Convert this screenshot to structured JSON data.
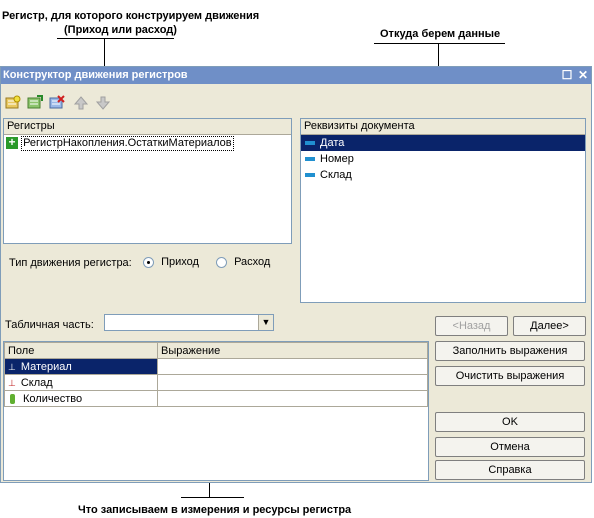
{
  "annotations": {
    "register_note_line1": "Регистр, для которого конструируем движения",
    "register_note_line2": "(Приход или расход)",
    "source_note": "Откуда берем данные",
    "bottom_note": "Что записываем в измерения и ресурсы регистра"
  },
  "window": {
    "title": "Конструктор движения регистров"
  },
  "registers_panel": {
    "header": "Регистры",
    "items": [
      {
        "label": "РегистрНакопления.ОстаткиМатериалов",
        "selected": true
      }
    ]
  },
  "movement_type": {
    "label": "Тип движения регистра:",
    "options": [
      "Приход",
      "Расход"
    ],
    "selected": "Приход"
  },
  "doc_attrs_panel": {
    "header": "Реквизиты документа",
    "items": [
      {
        "label": "Дата",
        "selected": true
      },
      {
        "label": "Номер",
        "selected": false
      },
      {
        "label": "Склад",
        "selected": false
      }
    ]
  },
  "table_part": {
    "label": "Табличная часть:",
    "value": ""
  },
  "nav_buttons": {
    "back": "<Назад",
    "next": "Далее>"
  },
  "fields_table": {
    "columns": [
      "Поле",
      "Выражение"
    ],
    "rows": [
      {
        "field": "Материал",
        "expression": "",
        "selected": true,
        "icon": "dimension-icon"
      },
      {
        "field": "Склад",
        "expression": "",
        "selected": false,
        "icon": "dimension-icon"
      },
      {
        "field": "Количество",
        "expression": "",
        "selected": false,
        "icon": "resource-icon"
      }
    ]
  },
  "side_buttons": {
    "fill": "Заполнить выражения",
    "clear": "Очистить выражения",
    "ok": "OK",
    "cancel": "Отмена",
    "help": "Справка"
  },
  "colors": {
    "titlebar": "#6f8fc7",
    "selection": "#0a246a",
    "window_bg": "#ece9d8"
  }
}
